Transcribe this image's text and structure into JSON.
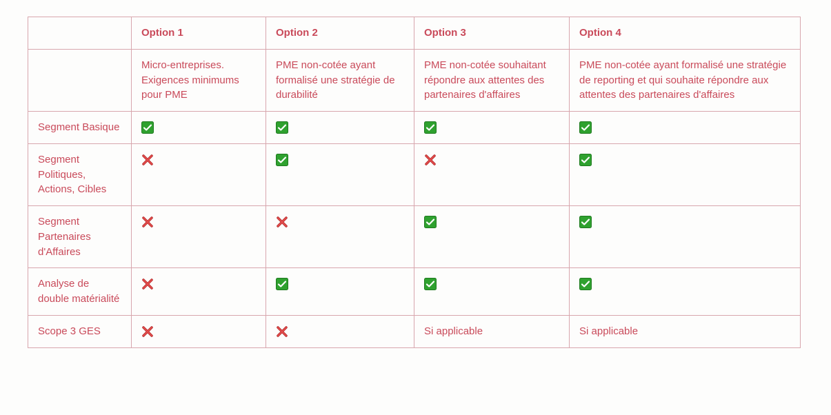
{
  "headers": {
    "row_label": "",
    "opt1": "Option 1",
    "opt2": "Option 2",
    "opt3": "Option 3",
    "opt4": "Option 4"
  },
  "descriptions": {
    "opt1": "Micro-entreprises. Exigences minimums pour PME",
    "opt2": "PME non-cotée ayant formalisé une stratégie de durabilité",
    "opt3": "PME non-cotée souhaitant répondre aux attentes des partenaires d'affaires",
    "opt4": "PME non-cotée ayant formalisé une stratégie de reporting et qui souhaite répondre aux attentes des partenaires d'affaires"
  },
  "rows": [
    {
      "label": "Segment Basique",
      "cells": [
        {
          "type": "check"
        },
        {
          "type": "check"
        },
        {
          "type": "check"
        },
        {
          "type": "check"
        }
      ]
    },
    {
      "label": "Segment Politiques, Actions, Cibles",
      "cells": [
        {
          "type": "cross"
        },
        {
          "type": "check"
        },
        {
          "type": "cross"
        },
        {
          "type": "check"
        }
      ]
    },
    {
      "label": "Segment Partenaires d'Affaires",
      "cells": [
        {
          "type": "cross"
        },
        {
          "type": "cross"
        },
        {
          "type": "check"
        },
        {
          "type": "check"
        }
      ]
    },
    {
      "label": "Analyse de double matérialité",
      "cells": [
        {
          "type": "cross"
        },
        {
          "type": "check"
        },
        {
          "type": "check"
        },
        {
          "type": "check"
        }
      ]
    },
    {
      "label": "Scope 3 GES",
      "cells": [
        {
          "type": "cross"
        },
        {
          "type": "cross"
        },
        {
          "type": "text",
          "text": "Si applicable"
        },
        {
          "type": "text",
          "text": "Si applicable"
        }
      ]
    }
  ],
  "chart_data": {
    "type": "table",
    "title": "",
    "columns": [
      "",
      "Option 1",
      "Option 2",
      "Option 3",
      "Option 4"
    ],
    "column_descriptions": {
      "Option 1": "Micro-entreprises. Exigences minimums pour PME",
      "Option 2": "PME non-cotée ayant formalisé une stratégie de durabilité",
      "Option 3": "PME non-cotée souhaitant répondre aux attentes des partenaires d'affaires",
      "Option 4": "PME non-cotée ayant formalisé une stratégie de reporting et qui souhaite répondre aux attentes des partenaires d'affaires"
    },
    "rows": [
      {
        "label": "Segment Basique",
        "values": [
          "yes",
          "yes",
          "yes",
          "yes"
        ]
      },
      {
        "label": "Segment Politiques, Actions, Cibles",
        "values": [
          "no",
          "yes",
          "no",
          "yes"
        ]
      },
      {
        "label": "Segment Partenaires d'Affaires",
        "values": [
          "no",
          "no",
          "yes",
          "yes"
        ]
      },
      {
        "label": "Analyse de double matérialité",
        "values": [
          "no",
          "yes",
          "yes",
          "yes"
        ]
      },
      {
        "label": "Scope 3 GES",
        "values": [
          "no",
          "no",
          "Si applicable",
          "Si applicable"
        ]
      }
    ]
  }
}
